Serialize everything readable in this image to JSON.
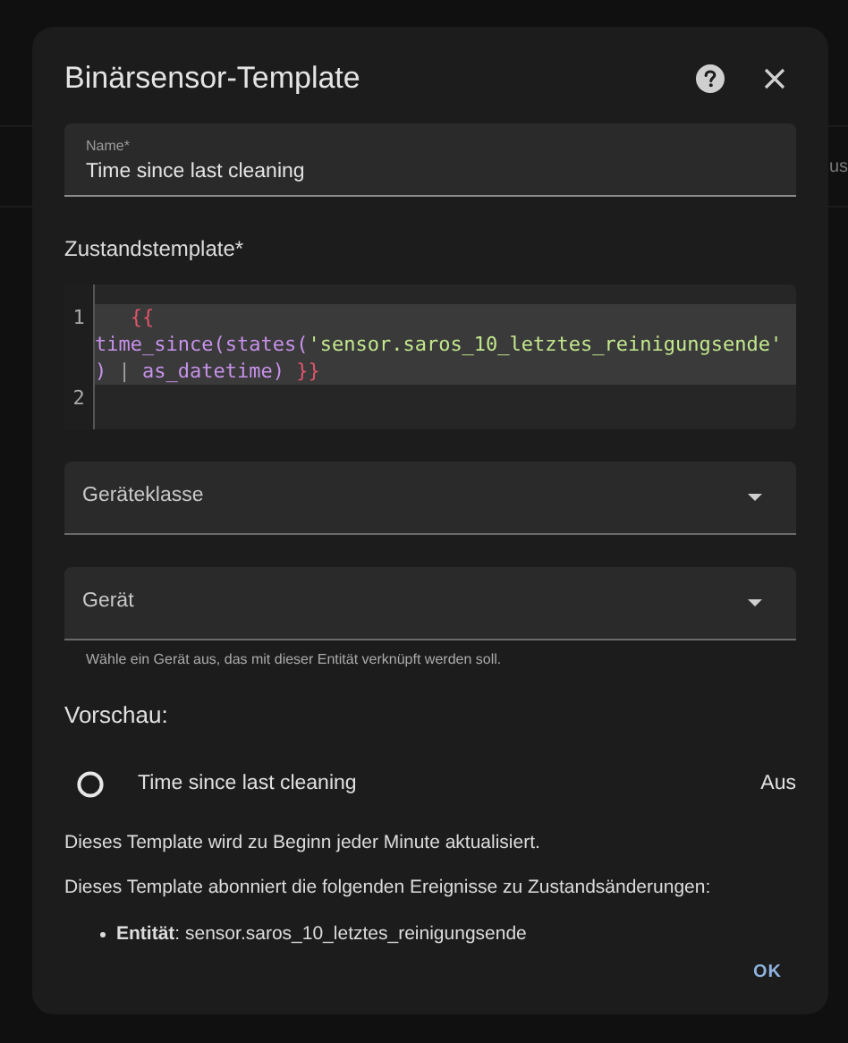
{
  "background": {
    "text": "us"
  },
  "dialog": {
    "title": "Binärsensor-Template",
    "name_field": {
      "label": "Name*",
      "value": "Time since last cleaning"
    },
    "template_label": "Zustandstemplate*",
    "code_lines": [
      {
        "number": "1",
        "tokens": [
          {
            "kind": "brace",
            "text": "{{ "
          },
          {
            "kind": "func",
            "text": "time_since(states("
          },
          {
            "kind": "string",
            "text": "'sensor.saros_10_letztes_reinigungsende'"
          },
          {
            "kind": "func",
            "text": ")"
          },
          {
            "kind": "plain",
            "text": " | "
          },
          {
            "kind": "func",
            "text": "as_datetime)"
          },
          {
            "kind": "brace",
            "text": " }}"
          }
        ],
        "selected": true
      },
      {
        "number": "2",
        "selected": false
      }
    ],
    "selects": [
      {
        "label": "Geräteklasse"
      },
      {
        "label": "Gerät",
        "helper": "Wähle ein Gerät aus, das mit dieser Entität verknüpft werden soll."
      }
    ],
    "preview_label": "Vorschau:",
    "preview": {
      "name": "Time since last cleaning",
      "state": "Aus"
    },
    "info": [
      "Dieses Template wird zu Beginn jeder Minute aktualisiert.",
      "Dieses Template abonniert die folgenden Ereignisse zu Zustandsänderungen:"
    ],
    "events": [
      "**Entität**: sensor.saros_10_letztes_reinigungsende"
    ],
    "ok": "OK"
  }
}
